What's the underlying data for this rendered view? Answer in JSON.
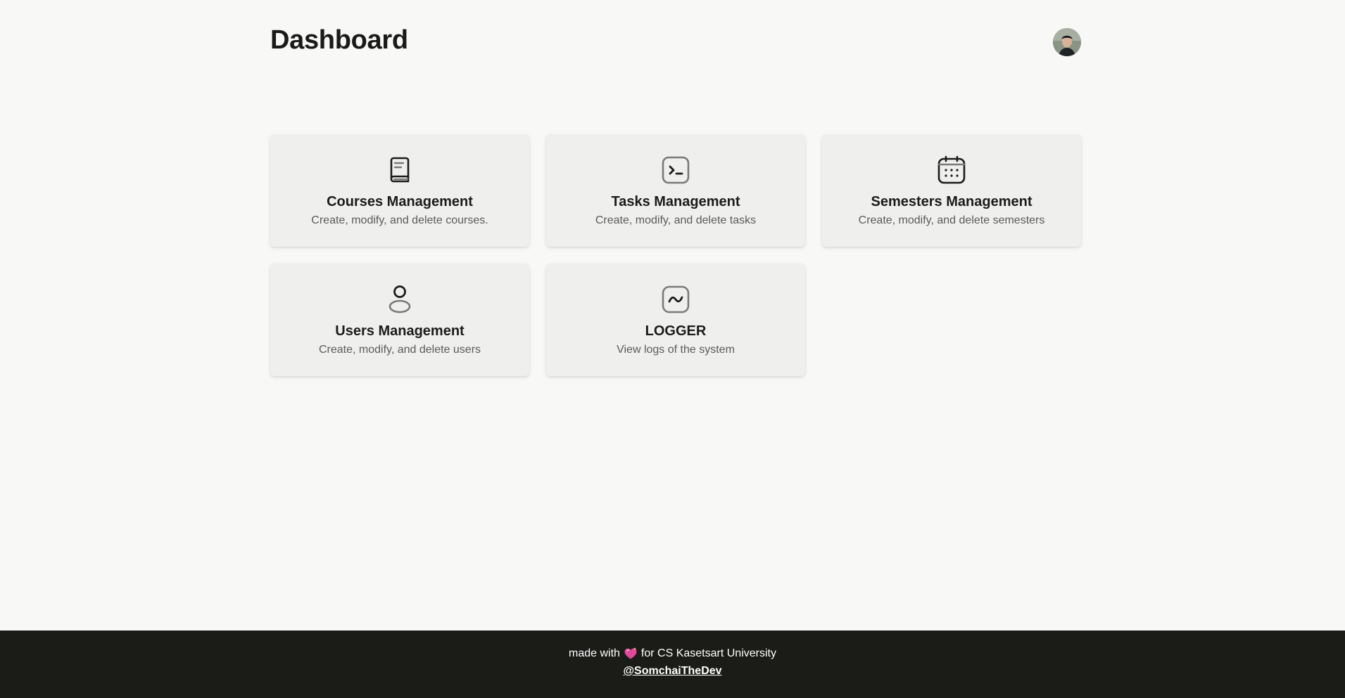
{
  "header": {
    "title": "Dashboard",
    "avatar_icon": "user-avatar-photo"
  },
  "cards": [
    {
      "title": "Courses Management",
      "description": "Create, modify, and delete courses.",
      "icon": "book-icon"
    },
    {
      "title": "Tasks Management",
      "description": "Create, modify, and delete tasks",
      "icon": "terminal-icon"
    },
    {
      "title": "Semesters Management",
      "description": "Create, modify, and delete semesters",
      "icon": "calendar-icon"
    },
    {
      "title": "Users Management",
      "description": "Create, modify, and delete users",
      "icon": "user-icon"
    },
    {
      "title": "LOGGER",
      "description": "View logs of the system",
      "icon": "activity-icon"
    }
  ],
  "footer": {
    "text_before": "made with",
    "text_after": "for CS Kasetsart University",
    "heart_icon": "sparkling-heart-icon",
    "link": "@SomchaiTheDev"
  },
  "colors": {
    "background": "#f8f8f6",
    "card": "#efefed",
    "footer": "#1b1c18",
    "heart": "#e0489a"
  }
}
